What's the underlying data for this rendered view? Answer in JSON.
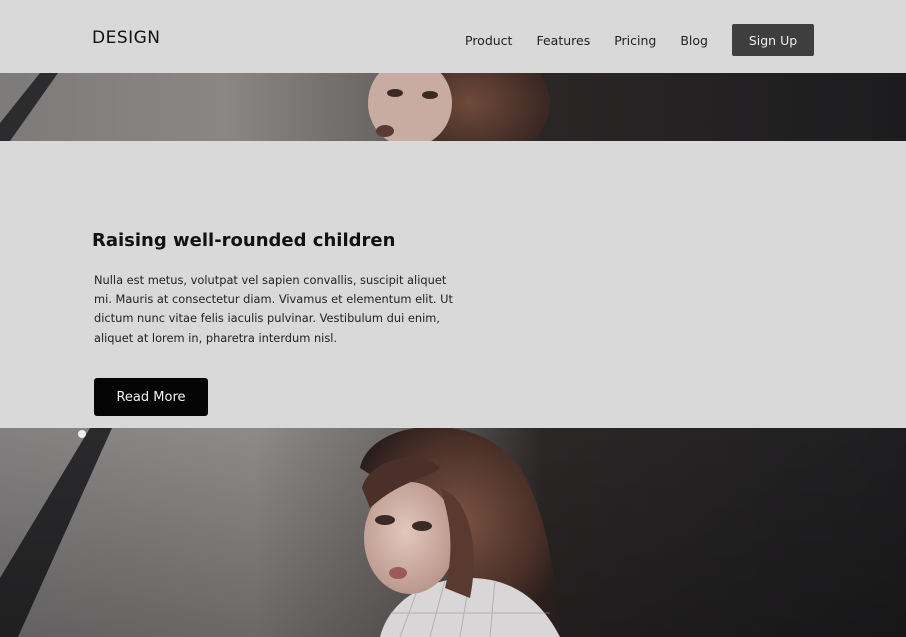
{
  "header": {
    "logo": "DESIGN",
    "nav": [
      {
        "label": "Product"
      },
      {
        "label": "Features"
      },
      {
        "label": "Pricing"
      },
      {
        "label": "Blog"
      }
    ],
    "signup_label": "Sign Up"
  },
  "article": {
    "title": "Raising well-rounded children",
    "body": "Nulla est metus, volutpat vel sapien convallis, suscipit aliquet mi. Mauris at consectetur diam. Vivamus et elementum elit. Ut dictum nunc vitae felis iaculis pulvinar. Vestibulum dui enim, aliquet at lorem in, pharetra interdum nisl.",
    "read_more_label": "Read More"
  },
  "colors": {
    "background": "#d9d9d9",
    "signup_button": "#3e3e3e",
    "read_more_button": "#050505"
  }
}
